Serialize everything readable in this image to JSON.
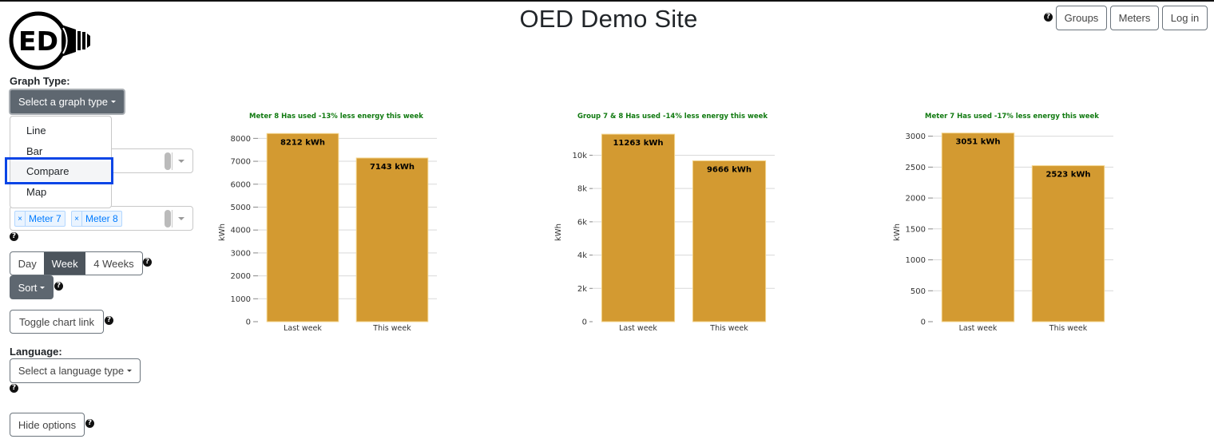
{
  "header": {
    "title": "OED Demo Site",
    "logo_text": "ED",
    "nav_buttons": [
      {
        "label": "Groups"
      },
      {
        "label": "Meters"
      },
      {
        "label": "Log in"
      }
    ],
    "help_icon": "question-circle-icon"
  },
  "sidebar": {
    "graph_type_label": "Graph Type:",
    "graph_type_button": "Select a graph type",
    "graph_type_options": [
      {
        "label": "Line"
      },
      {
        "label": "Bar"
      },
      {
        "label": "Compare",
        "highlighted": true
      },
      {
        "label": "Map"
      }
    ],
    "meter_tags": [
      {
        "label": "Meter 7"
      },
      {
        "label": "Meter 8"
      }
    ],
    "time_interval": {
      "options": [
        {
          "label": "Day",
          "active": false
        },
        {
          "label": "Week",
          "active": true
        },
        {
          "label": "4 Weeks",
          "active": false
        }
      ]
    },
    "sort_button": "Sort",
    "toggle_chart_link": "Toggle chart link",
    "language_label": "Language:",
    "language_button": "Select a language type",
    "hide_options": "Hide options"
  },
  "colors": {
    "bar": "#d39a31",
    "title_green": "#107a10",
    "highlight_border": "#0a45e6"
  },
  "chart_data": [
    {
      "type": "bar",
      "title": "Meter 8 Has used -13% less energy this week",
      "categories": [
        "Last week",
        "This week"
      ],
      "values": [
        8212,
        7143
      ],
      "data_labels": [
        "8212 kWh",
        "7143 kWh"
      ],
      "xlabel": "",
      "ylabel": "kWh",
      "ylim": [
        0,
        8500
      ],
      "yticks": [
        0,
        1000,
        2000,
        3000,
        4000,
        5000,
        6000,
        7000,
        8000
      ],
      "ytick_labels": [
        "0",
        "1000",
        "2000",
        "3000",
        "4000",
        "5000",
        "6000",
        "7000",
        "8000"
      ],
      "grid": true
    },
    {
      "type": "bar",
      "title": "Group 7 & 8 Has used -14% less energy this week",
      "categories": [
        "Last week",
        "This week"
      ],
      "values": [
        11263,
        9666
      ],
      "data_labels": [
        "11263 kWh",
        "9666 kWh"
      ],
      "xlabel": "",
      "ylabel": "kWh",
      "ylim": [
        0,
        11700
      ],
      "yticks": [
        0,
        2000,
        4000,
        6000,
        8000,
        10000
      ],
      "ytick_labels": [
        "0",
        "2k",
        "4k",
        "6k",
        "8k",
        "10k"
      ],
      "grid": true
    },
    {
      "type": "bar",
      "title": "Meter 7 Has used -17% less energy this week",
      "categories": [
        "Last week",
        "This week"
      ],
      "values": [
        3051,
        2523
      ],
      "data_labels": [
        "3051 kWh",
        "2523 kWh"
      ],
      "xlabel": "",
      "ylabel": "kWh",
      "ylim": [
        0,
        3150
      ],
      "yticks": [
        0,
        500,
        1000,
        1500,
        2000,
        2500,
        3000
      ],
      "ytick_labels": [
        "0",
        "500",
        "1000",
        "1500",
        "2000",
        "2500",
        "3000"
      ],
      "grid": true
    }
  ]
}
